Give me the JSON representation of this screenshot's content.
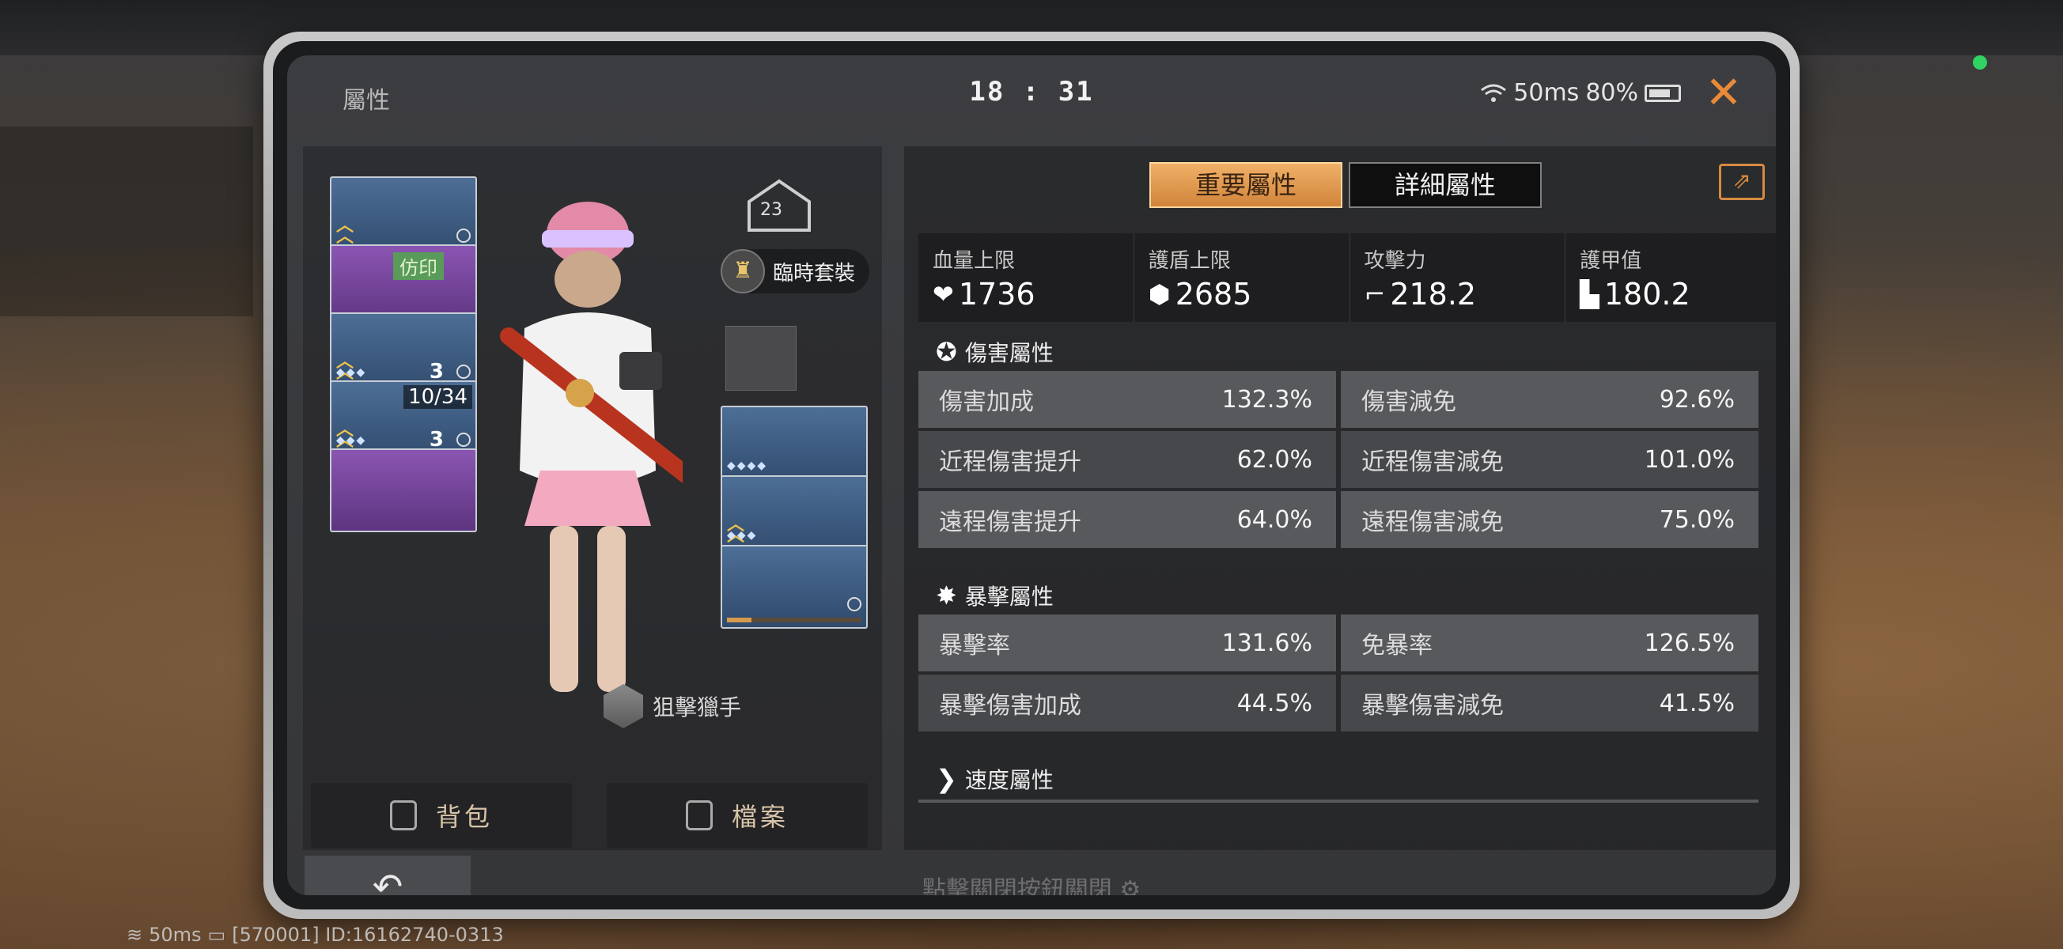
{
  "header": {
    "tab_label": "屬性",
    "clock": "18 : 31",
    "ping": "50ms",
    "battery": "80%"
  },
  "left": {
    "level": "23",
    "outfit_label": "臨時套裝",
    "class_label": "狙擊獵手",
    "slot_fang": "仿印",
    "slot_weapon_count": "10/34",
    "slot_armor_num": "3",
    "slot_weapon_num": "3",
    "backpack_label": "背包",
    "archive_label": "檔案"
  },
  "tabs": {
    "important": "重要屬性",
    "detailed": "詳細屬性"
  },
  "main_stats": [
    {
      "label": "血量上限",
      "value": "1736",
      "icon": "heart-icon"
    },
    {
      "label": "護盾上限",
      "value": "2685",
      "icon": "shield-icon"
    },
    {
      "label": "攻擊力",
      "value": "218.2",
      "icon": "gun-icon"
    },
    {
      "label": "護甲值",
      "value": "180.2",
      "icon": "armor-icon"
    }
  ],
  "damage": {
    "title": "傷害屬性",
    "rows": [
      {
        "k": "傷害加成",
        "v": "132.3%"
      },
      {
        "k": "傷害減免",
        "v": "92.6%"
      },
      {
        "k": "近程傷害提升",
        "v": "62.0%"
      },
      {
        "k": "近程傷害減免",
        "v": "101.0%"
      },
      {
        "k": "遠程傷害提升",
        "v": "64.0%"
      },
      {
        "k": "遠程傷害減免",
        "v": "75.0%"
      }
    ]
  },
  "crit": {
    "title": "暴擊屬性",
    "rows": [
      {
        "k": "暴擊率",
        "v": "131.6%"
      },
      {
        "k": "免暴率",
        "v": "126.5%"
      },
      {
        "k": "暴擊傷害加成",
        "v": "44.5%"
      },
      {
        "k": "暴擊傷害減免",
        "v": "41.5%"
      }
    ]
  },
  "speed": {
    "title": "速度屬性"
  },
  "footer": {
    "hint": "點擊關閉按鈕關閉",
    "ping": "50ms",
    "server": "[570001] ID:16162740-0313"
  }
}
